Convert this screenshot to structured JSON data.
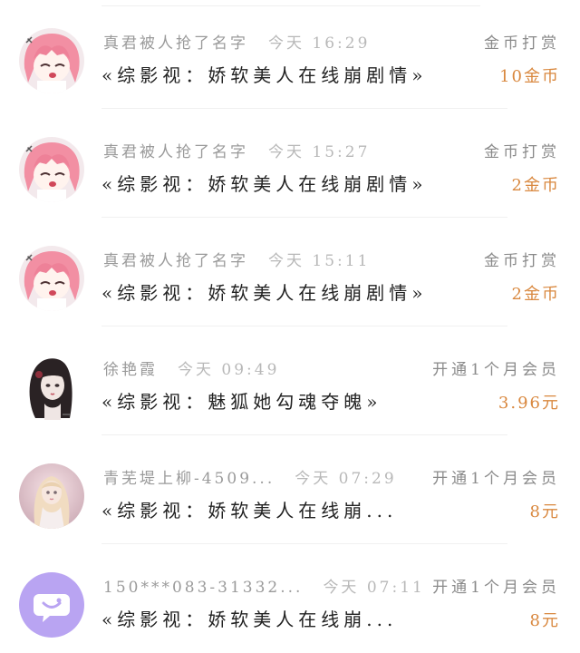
{
  "accent_color": "#d9883f",
  "rows": [
    {
      "name": "真君被人抢了名字",
      "time": "今天 16:29",
      "action": "金币打赏",
      "novel": "«综影视：娇软美人在线崩剧情»",
      "amount": "10金币",
      "avatar_icon": "anime-girl-pink-hair-avatar"
    },
    {
      "name": "真君被人抢了名字",
      "time": "今天 15:27",
      "action": "金币打赏",
      "novel": "«综影视：娇软美人在线崩剧情»",
      "amount": "2金币",
      "avatar_icon": "anime-girl-pink-hair-avatar"
    },
    {
      "name": "真君被人抢了名字",
      "time": "今天 15:11",
      "action": "金币打赏",
      "novel": "«综影视：娇软美人在线崩剧情»",
      "amount": "2金币",
      "avatar_icon": "anime-girl-pink-hair-avatar"
    },
    {
      "name": "徐艳霞",
      "time": "今天 09:49",
      "action": "开通1个月会员",
      "novel": "«综影视：魅狐她勾魂夺魄»",
      "amount": "3.96元",
      "avatar_icon": "dark-hair-lady-avatar"
    },
    {
      "name": "青芜堤上柳-4509...",
      "time": "今天 07:29",
      "action": "开通1个月会员",
      "novel": "«综影视：娇软美人在线崩...",
      "amount": "8元",
      "avatar_icon": "blonde-doll-avatar"
    },
    {
      "name": "150***083-31332...",
      "time": "今天 07:11",
      "action": "开通1个月会员",
      "novel": "«综影视：娇软美人在线崩...",
      "amount": "8元",
      "avatar_icon": "chat-bubble-default-avatar"
    }
  ]
}
